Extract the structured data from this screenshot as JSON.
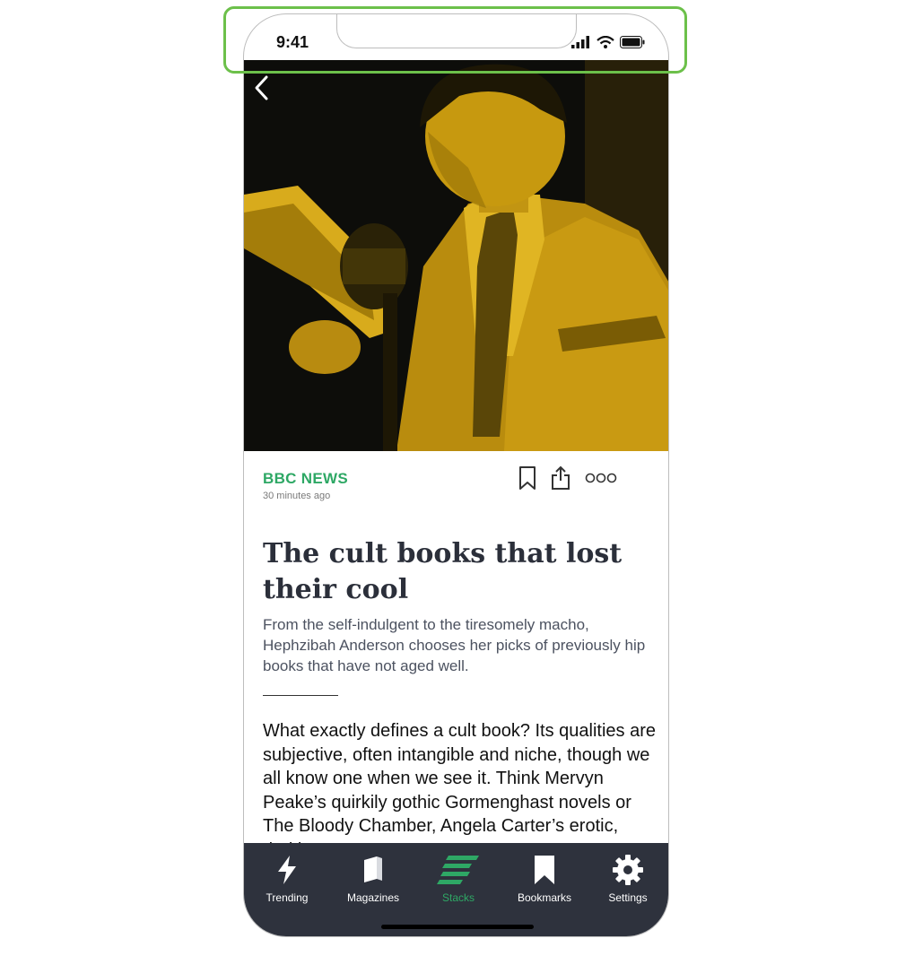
{
  "status_bar": {
    "time": "9:41"
  },
  "article": {
    "source": "BBC NEWS",
    "time_ago": "30 minutes ago",
    "headline": "The cult books that lost their cool",
    "dek": "From the self-indulgent to the tiresomely macho, Hephzibah Anderson chooses her picks of previously hip books that have not aged well.",
    "body": "What exactly defines a cult book? Its qualities are subjective, often intangible and niche, though we all know one when we see it. Think Mervyn Peake’s quirkily gothic Gormenghast novels or The Bloody Chamber, Angela Carter’s erotic, darkly"
  },
  "actions": {
    "bookmark_icon": "bookmark-icon",
    "share_icon": "share-icon",
    "more_icon": "more-icon"
  },
  "tabbar": {
    "tabs": [
      {
        "label": "Trending",
        "icon": "lightning-icon"
      },
      {
        "label": "Magazines",
        "icon": "magazine-icon"
      },
      {
        "label": "Stacks",
        "icon": "stacks-icon",
        "active": true
      },
      {
        "label": "Bookmarks",
        "icon": "bookmark-icon"
      },
      {
        "label": "Settings",
        "icon": "gear-icon"
      }
    ]
  },
  "colors": {
    "accent": "#2ea865",
    "tabbar_bg": "#2e323d",
    "hero_tint": "#d9a50c",
    "headline": "#2b2f3a"
  }
}
